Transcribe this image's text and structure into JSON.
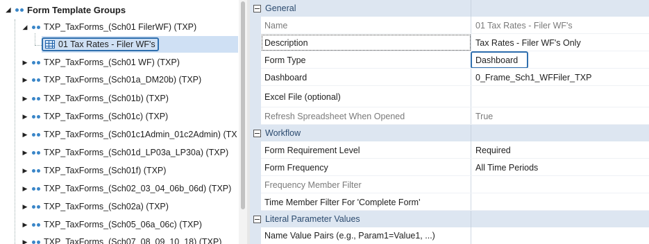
{
  "tree": {
    "root_label": "Form Template Groups",
    "items": [
      {
        "label": "TXP_TaxForms_(Sch01 FilerWF) (TXP)",
        "expanded": true
      },
      {
        "label": "01 Tax Rates - Filer WF's",
        "child": true,
        "selected": true
      },
      {
        "label": "TXP_TaxForms_(Sch01 WF) (TXP)"
      },
      {
        "label": "TXP_TaxForms_(Sch01a_DM20b) (TXP)"
      },
      {
        "label": "TXP_TaxForms_(Sch01b) (TXP)"
      },
      {
        "label": "TXP_TaxForms_(Sch01c) (TXP)"
      },
      {
        "label": "TXP_TaxForms_(Sch01c1Admin_01c2Admin) (TX"
      },
      {
        "label": "TXP_TaxForms_(Sch01d_LP03a_LP30a) (TXP)"
      },
      {
        "label": "TXP_TaxForms_(Sch01f) (TXP)"
      },
      {
        "label": "TXP_TaxForms_(Sch02_03_04_06b_06d) (TXP)"
      },
      {
        "label": "TXP_TaxForms_(Sch02a) (TXP)"
      },
      {
        "label": "TXP_TaxForms_(Sch05_06a_06c) (TXP)"
      },
      {
        "label": "TXP_TaxForms_(Sch07_08_09_10_18) (TXP)"
      }
    ]
  },
  "properties": {
    "general": {
      "title": "General",
      "rows": [
        {
          "name": "Name",
          "value": "01 Tax Rates - Filer WF's",
          "dim_value": true
        },
        {
          "name": "Description",
          "value": "Tax Rates - Filer WF's Only"
        },
        {
          "name": "Form Type",
          "value": "Dashboard"
        },
        {
          "name": "Dashboard",
          "value": "0_Frame_Sch1_WFFiler_TXP"
        },
        {
          "name": "Excel File (optional)",
          "value": ""
        },
        {
          "name": "Refresh Spreadsheet When Opened",
          "value": "True",
          "dim_name": true,
          "dim_value": true
        }
      ]
    },
    "workflow": {
      "title": "Workflow",
      "rows": [
        {
          "name": "Form Requirement Level",
          "value": "Required"
        },
        {
          "name": "Form Frequency",
          "value": "All Time Periods"
        },
        {
          "name": "Frequency Member Filter",
          "value": "",
          "dim_name": true
        },
        {
          "name": "Time Member Filter For 'Complete Form'",
          "value": ""
        }
      ]
    },
    "literal": {
      "title": "Literal Parameter Values",
      "rows": [
        {
          "name": "Name Value Pairs (e.g., Param1=Value1, ...)",
          "value": ""
        }
      ]
    }
  },
  "colors": {
    "accent": "#2f6fae",
    "category_bg": "#dde6f1",
    "selection": "#cfe0f4",
    "node_icon": "#3a86c8"
  },
  "icons": {
    "node": "dots-icon",
    "form": "grid-icon",
    "expand": "triangle-right-icon",
    "collapse": "triangle-down-icon",
    "category_toggle": "minus-box-icon"
  }
}
